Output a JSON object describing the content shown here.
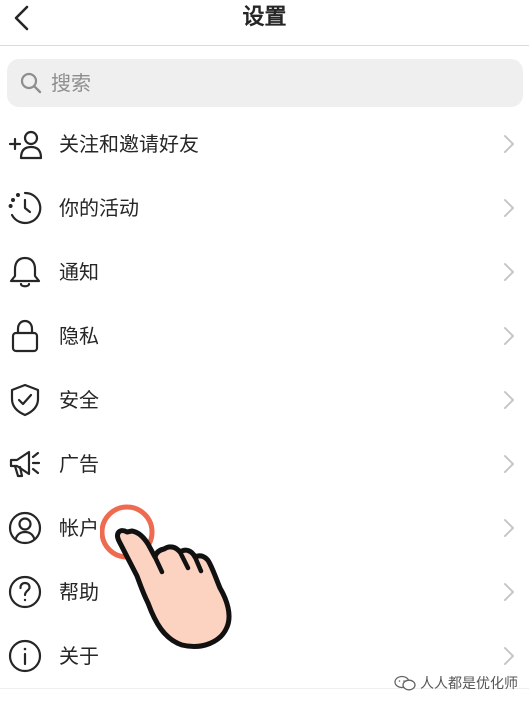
{
  "header": {
    "title": "设置"
  },
  "search": {
    "placeholder": "搜索"
  },
  "menu": {
    "items": [
      {
        "label": "关注和邀请好友",
        "icon": "add-person-icon"
      },
      {
        "label": "你的活动",
        "icon": "activity-clock-icon"
      },
      {
        "label": "通知",
        "icon": "bell-icon"
      },
      {
        "label": "隐私",
        "icon": "lock-icon"
      },
      {
        "label": "安全",
        "icon": "shield-check-icon"
      },
      {
        "label": "广告",
        "icon": "megaphone-icon"
      },
      {
        "label": "帐户",
        "icon": "account-circle-icon"
      },
      {
        "label": "帮助",
        "icon": "help-circle-icon"
      },
      {
        "label": "关于",
        "icon": "info-circle-icon"
      }
    ]
  },
  "overlay": {
    "pointer": "tap-hand-icon",
    "tap_ring_color": "#ef6b4f",
    "hand_color": "#fcd3c1"
  },
  "watermark": {
    "text": "人人都是优化师"
  },
  "colors": {
    "text": "#262626",
    "chevron": "#c7c7c7",
    "search_bg": "#efefef",
    "divider": "#dbdbdb"
  }
}
